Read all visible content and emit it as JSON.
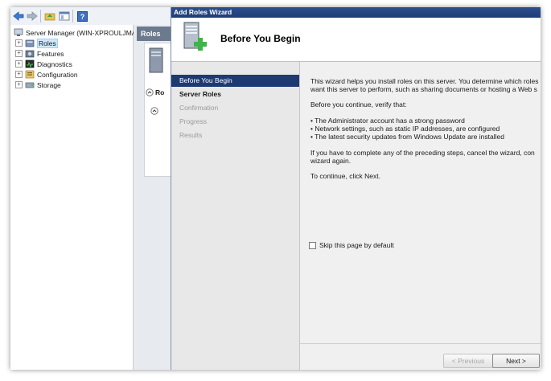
{
  "window": {
    "title": "Add Roles Wizard"
  },
  "tree": {
    "root_label": "Server Manager (WIN-XPROULJMA",
    "items": [
      {
        "label": "Roles",
        "selected": true,
        "icon": "roles-icon"
      },
      {
        "label": "Features",
        "selected": false,
        "icon": "features-icon"
      },
      {
        "label": "Diagnostics",
        "selected": false,
        "icon": "diagnostics-icon"
      },
      {
        "label": "Configuration",
        "selected": false,
        "icon": "configuration-icon"
      },
      {
        "label": "Storage",
        "selected": false,
        "icon": "storage-icon"
      }
    ]
  },
  "middle": {
    "tab_label": "Roles",
    "section_label": "Ro"
  },
  "wizard": {
    "page_title": "Before You Begin",
    "steps": [
      {
        "label": "Before You Begin",
        "state": "active"
      },
      {
        "label": "Server Roles",
        "state": "bold"
      },
      {
        "label": "Confirmation",
        "state": "dim"
      },
      {
        "label": "Progress",
        "state": "dim"
      },
      {
        "label": "Results",
        "state": "dim"
      }
    ],
    "content": {
      "intro_line1": "This wizard helps you install roles on this server. You determine which roles",
      "intro_line2": "want this server to perform, such as sharing documents or hosting a Web s",
      "verify": "Before you continue, verify that:",
      "bullet1": "• The Administrator account has a strong password",
      "bullet2": "• Network settings, such as static IP addresses, are configured",
      "bullet3": "• The latest security updates from Windows Update are installed",
      "complete_line1": "If you have to complete any of the preceding steps, cancel the wizard, con",
      "complete_line2": "wizard again.",
      "continue": "To continue, click Next.",
      "skip_label": "Skip this page by default"
    },
    "buttons": {
      "previous": "< Previous",
      "next": "Next >"
    }
  },
  "colors": {
    "accent": "#1e3a73",
    "selection": "#cde8ff"
  }
}
